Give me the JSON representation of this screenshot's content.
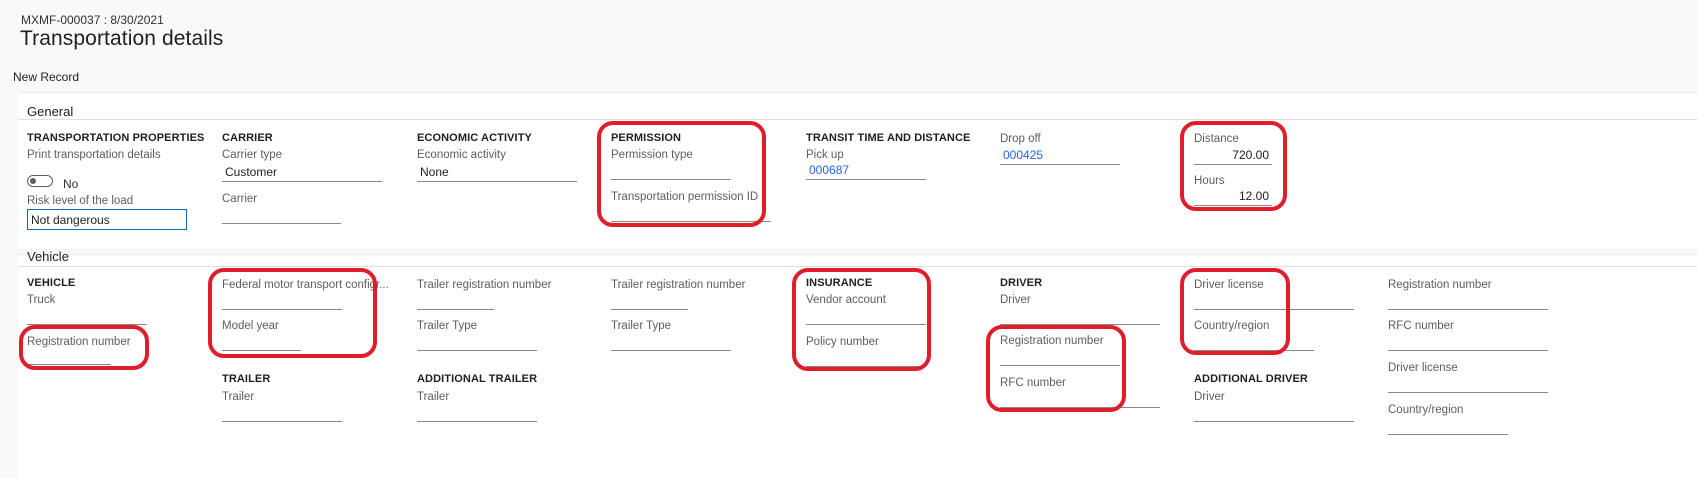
{
  "header": {
    "record_id": "MXMF-000037 : 8/30/2021",
    "title": "Transportation details",
    "new_record_label": "New Record"
  },
  "general": {
    "section_label": "General",
    "transportation_properties": {
      "heading": "TRANSPORTATION PROPERTIES",
      "print_label": "Print transportation details",
      "print_toggle_text": "No",
      "risk_label": "Risk level of the load",
      "risk_value": "Not dangerous"
    },
    "carrier": {
      "heading": "CARRIER",
      "carrier_type_label": "Carrier type",
      "carrier_type_value": "Customer",
      "carrier_label": "Carrier",
      "carrier_value": ""
    },
    "economic_activity": {
      "heading": "ECONOMIC ACTIVITY",
      "label": "Economic activity",
      "value": "None"
    },
    "permission": {
      "heading": "PERMISSION",
      "type_label": "Permission type",
      "type_value": "",
      "id_label": "Transportation permission ID",
      "id_value": ""
    },
    "transit": {
      "heading": "TRANSIT TIME AND DISTANCE",
      "pickup_label": "Pick up",
      "pickup_value": "000687",
      "dropoff_label": "Drop off",
      "dropoff_value": "000425",
      "distance_label": "Distance",
      "distance_value": "720.00",
      "hours_label": "Hours",
      "hours_value": "12.00"
    }
  },
  "vehicle": {
    "section_label": "Vehicle",
    "vehicle_group": {
      "heading": "VEHICLE",
      "truck_label": "Truck",
      "registration_label": "Registration number"
    },
    "federal": {
      "federal_label": "Federal motor transport configr...",
      "model_year_label": "Model year"
    },
    "trailer": {
      "heading": "TRAILER",
      "trailer_label": "Trailer"
    },
    "trailer_col1": {
      "reg_label": "Trailer registration number",
      "type_label": "Trailer Type"
    },
    "additional_trailer": {
      "heading": "ADDITIONAL TRAILER",
      "trailer_label": "Trailer"
    },
    "trailer_col2": {
      "reg_label": "Trailer registration number",
      "type_label": "Trailer Type"
    },
    "insurance": {
      "heading": "INSURANCE",
      "vendor_label": "Vendor account",
      "policy_label": "Policy number"
    },
    "driver": {
      "heading": "DRIVER",
      "driver_label": "Driver",
      "registration_label": "Registration number",
      "rfc_label": "RFC number"
    },
    "driver_details": {
      "license_label": "Driver license",
      "country_label": "Country/region"
    },
    "additional_driver": {
      "heading": "ADDITIONAL DRIVER",
      "driver_label": "Driver"
    },
    "additional_driver_details": {
      "registration_label": "Registration number",
      "rfc_label": "RFC number",
      "license_label": "Driver license",
      "country_label": "Country/region"
    }
  },
  "colors": {
    "highlight": "#e01e2b",
    "link": "#2266e3",
    "focus_border": "#0f6cbd"
  }
}
